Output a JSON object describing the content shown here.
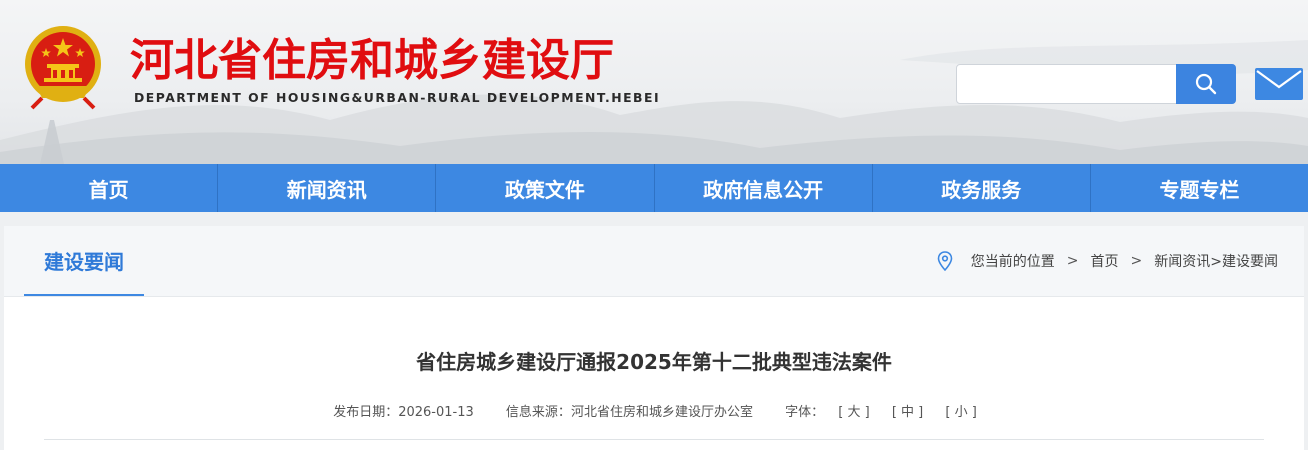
{
  "header": {
    "site_title": "河北省住房和城乡建设厅",
    "site_subtitle": "DEPARTMENT OF HOUSING&URBAN-RURAL DEVELOPMENT.HEBEI",
    "search": {
      "placeholder": "",
      "value": ""
    },
    "brand_color": "#e00d10"
  },
  "nav": {
    "items": [
      {
        "label": "首页"
      },
      {
        "label": "新闻资讯"
      },
      {
        "label": "政策文件"
      },
      {
        "label": "政府信息公开"
      },
      {
        "label": "政务服务"
      },
      {
        "label": "专题专栏"
      }
    ],
    "color": "#3d88e2"
  },
  "section": {
    "title": "建设要闻"
  },
  "breadcrumb": {
    "prefix": "您当前的位置",
    "sep": ">",
    "home": "首页",
    "trail": "新闻资讯>建设要闻"
  },
  "article": {
    "title": "省住房城乡建设厅通报2025年第十二批典型违法案件",
    "date_label": "发布日期：",
    "date": "2026-01-13",
    "source_label": "信息来源：",
    "source": "河北省住房和城乡建设厅办公室",
    "font_label": "字体：",
    "font_large": "[ 大 ]",
    "font_medium": "[ 中 ]",
    "font_small": "[ 小 ]"
  }
}
